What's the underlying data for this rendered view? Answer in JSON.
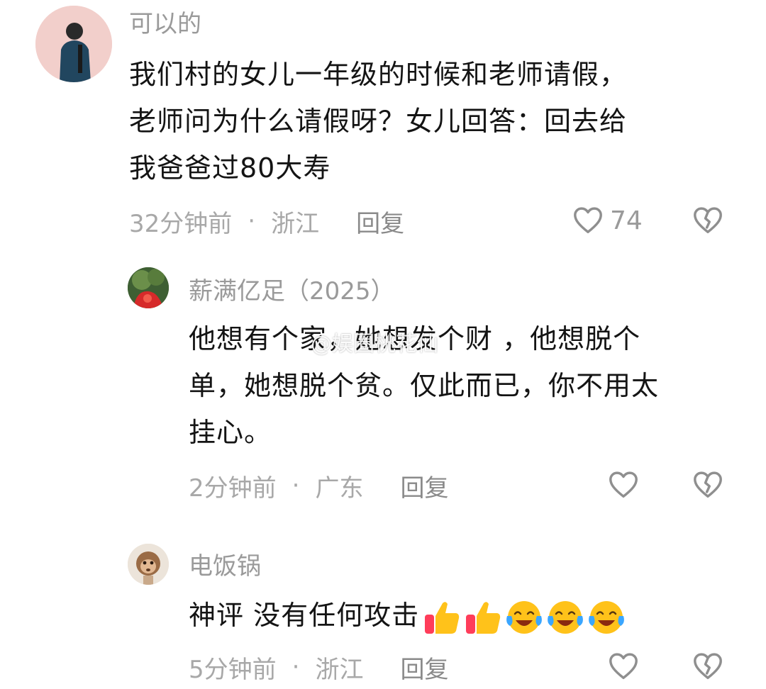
{
  "comments": [
    {
      "username": "可以的",
      "content_lines": [
        "我们村的女儿一年级的时候和老师请假，",
        "老师问为什么请假呀？女儿回答：回去给",
        "我爸爸过80大寿"
      ],
      "time": "32分钟前",
      "separator": "·",
      "location": "浙江",
      "reply_label": "回复",
      "like_count": "74"
    },
    {
      "username": "薪满亿足（2025）",
      "content_lines": [
        "他想有个家，她想发个财 ，他想脱个",
        "单，她想脱个贫。仅此而已，你不用太",
        "挂心。"
      ],
      "time": "2分钟前",
      "separator": "·",
      "location": "广东",
      "reply_label": "回复"
    },
    {
      "username": "电饭锅",
      "content_text": "神评 没有任何攻击",
      "emojis": [
        "thumbs-up",
        "thumbs-up",
        "tears-of-joy",
        "tears-of-joy",
        "tears-of-joy"
      ],
      "time": "5分钟前",
      "separator": "·",
      "location": "浙江",
      "reply_label": "回复"
    }
  ],
  "watermark": "@娱圈桃花仙",
  "icons": {
    "like": "heart-outline-icon",
    "dislike": "broken-heart-icon",
    "emoji_thumbs": "thumbs-up-emoji",
    "emoji_laugh": "tears-of-joy-emoji"
  },
  "colors": {
    "text": "#141414",
    "muted": "#a8a8a8",
    "icon": "#8f8f8f"
  }
}
